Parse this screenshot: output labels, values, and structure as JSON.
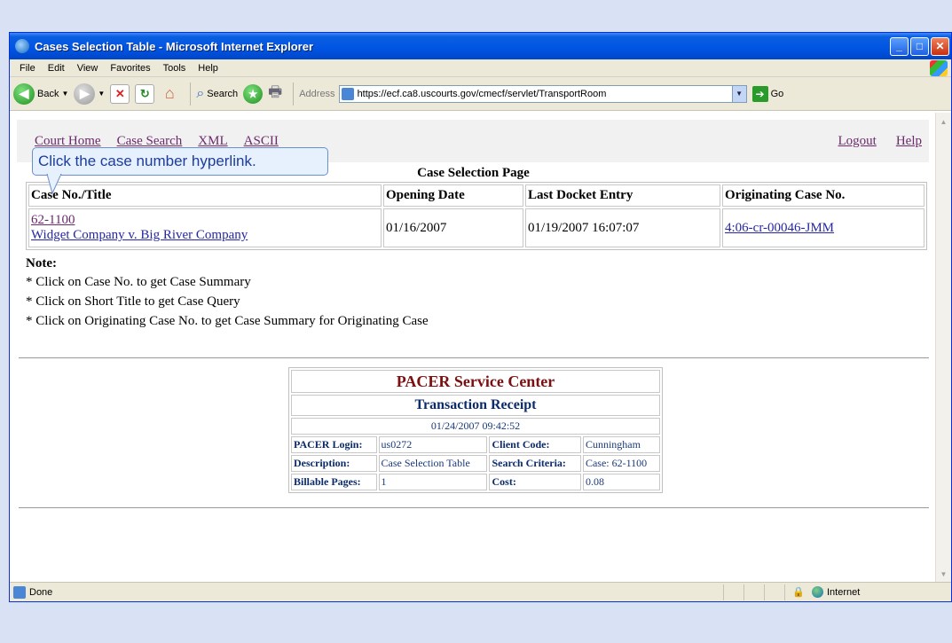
{
  "window": {
    "title": "Cases Selection Table - Microsoft Internet Explorer"
  },
  "menu": [
    "File",
    "Edit",
    "View",
    "Favorites",
    "Tools",
    "Help"
  ],
  "toolbar": {
    "back_label": "Back",
    "search_label": "Search",
    "address_label": "Address",
    "url": "https://ecf.ca8.uscourts.gov/cmecf/servlet/TransportRoom",
    "go_label": "Go"
  },
  "nav": {
    "court_home": "Court Home",
    "case_search": "Case Search",
    "xml": "XML",
    "ascii": "ASCII",
    "logout": "Logout",
    "help": "Help"
  },
  "page_title": "Case Selection Page",
  "callout": "Click the case number hyperlink.",
  "case_table": {
    "headers": [
      "Case No./Title",
      "Opening Date",
      "Last Docket Entry",
      "Originating Case No."
    ],
    "rows": [
      {
        "case_no": "62-1100",
        "title": "Widget Company v. Big River Company",
        "opening_date": "01/16/2007",
        "last_docket": "01/19/2007 16:07:07",
        "originating": "4:06-cr-00046-JMM"
      }
    ]
  },
  "notes": {
    "heading": "Note:",
    "lines": [
      "* Click on Case No. to get Case Summary",
      "* Click on Short Title to get Case Query",
      "* Click on Originating Case No. to get Case Summary for Originating Case"
    ]
  },
  "receipt": {
    "title": "PACER Service Center",
    "subtitle": "Transaction Receipt",
    "datetime": "01/24/2007 09:42:52",
    "rows": [
      {
        "k1": "PACER Login:",
        "v1": "us0272",
        "k2": "Client Code:",
        "v2": "Cunningham"
      },
      {
        "k1": "Description:",
        "v1": "Case Selection Table",
        "k2": "Search Criteria:",
        "v2": "Case: 62-1100"
      },
      {
        "k1": "Billable Pages:",
        "v1": "1",
        "k2": "Cost:",
        "v2": "0.08"
      }
    ]
  },
  "status": {
    "text": "Done",
    "zone": "Internet"
  },
  "colors": {
    "titlebar": "#0054e3",
    "link": "#2626a6",
    "visited": "#6b2a6b",
    "receipt_title": "#7b1010"
  }
}
